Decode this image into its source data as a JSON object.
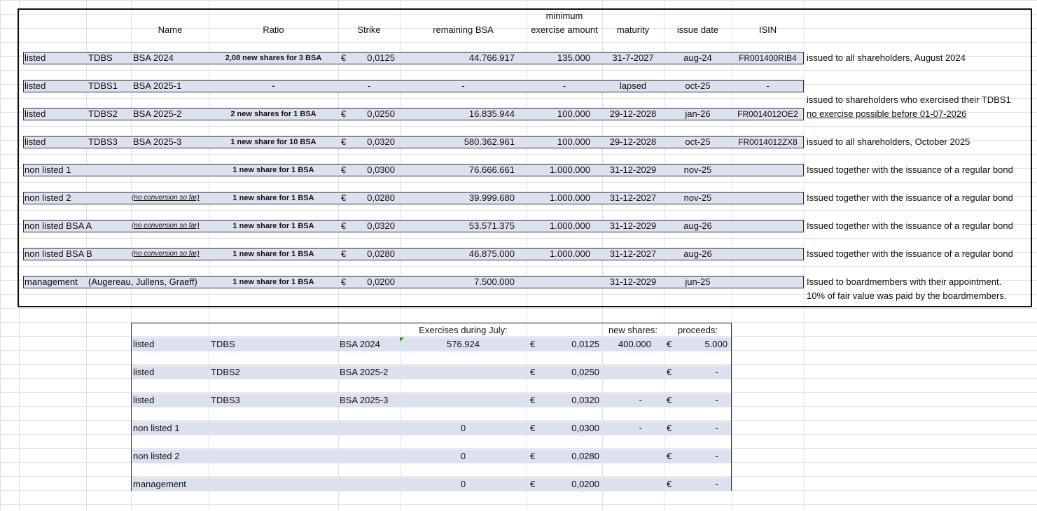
{
  "headers": {
    "name": "Name",
    "ratio": "Ratio",
    "strike": "Strike",
    "remaining": "remaining BSA",
    "min_line1": "minimum",
    "min_line2": "exercise amount",
    "maturity": "maturity",
    "issue_date": "issue date",
    "isin": "ISIN"
  },
  "rows": [
    {
      "status": "listed",
      "code": "TDBS",
      "name": "BSA 2024",
      "ratio": "2,08 new shares for 3 BSA",
      "cur": "€",
      "strike": "0,0125",
      "remaining": "44.766.917",
      "min": "135.000",
      "maturity": "31-7-2027",
      "issue": "aug-24",
      "isin": "FR001400RIB4",
      "note": "issued to all shareholders, August 2024"
    },
    {
      "status": "listed",
      "code": "TDBS1",
      "name": "BSA 2025-1",
      "ratio": "-",
      "cur": "",
      "strike": "-",
      "remaining": "-",
      "min": "-",
      "maturity": "lapsed",
      "issue": "oct-25",
      "isin": "-",
      "note": ""
    },
    {
      "status": "listed",
      "code": "TDBS2",
      "name": "BSA 2025-2",
      "ratio": "2 new shares for 1 BSA",
      "cur": "€",
      "strike": "0,0250",
      "remaining": "16.835.944",
      "min": "100.000",
      "maturity": "29-12-2028",
      "issue": "jan-26",
      "isin": "FR0014012OE2",
      "note_above": "issued to shareholders who exercised their TDBS1",
      "note": "no exercise possible before 01-07-2026"
    },
    {
      "status": "listed",
      "code": "TDBS3",
      "name": "BSA 2025-3",
      "ratio": "1 new share for 10 BSA",
      "cur": "€",
      "strike": "0,0320",
      "remaining": "580.362.961",
      "min": "100.000",
      "maturity": "29-12-2028",
      "issue": "oct-25",
      "isin": "FR0014012ZX8",
      "note": "issued to all shareholders, October 2025"
    },
    {
      "status": "non listed 1",
      "code": "",
      "name": "",
      "ratio": "1 new share for 1 BSA",
      "cur": "€",
      "strike": "0,0300",
      "remaining": "76.666.661",
      "min": "1.000.000",
      "maturity": "31-12-2029",
      "issue": "nov-25",
      "isin": "",
      "note": "Issued together with the issuance of a regular bond"
    },
    {
      "status": "non listed 2",
      "code": "",
      "name": "(no conversion so far)",
      "ratio": "1 new share for 1 BSA",
      "cur": "€",
      "strike": "0,0280",
      "remaining": "39.999.680",
      "min": "1.000.000",
      "maturity": "31-12-2027",
      "issue": "nov-25",
      "isin": "",
      "note": "Issued together with the issuance of a regular bond"
    },
    {
      "status": "non listed BSA A",
      "code": "",
      "name": "(no conversion so far)",
      "ratio": "1 new share for 1 BSA",
      "cur": "€",
      "strike": "0,0320",
      "remaining": "53.571.375",
      "min": "1.000.000",
      "maturity": "31-12-2029",
      "issue": "aug-26",
      "isin": "",
      "note": "Issued together with the issuance of a regular bond"
    },
    {
      "status": "non listed BSA B",
      "code": "",
      "name": "(no conversion so far)",
      "ratio": "1 new share for 1 BSA",
      "cur": "€",
      "strike": "0,0280",
      "remaining": "46.875.000",
      "min": "1.000.000",
      "maturity": "31-12-2027",
      "issue": "aug-26",
      "isin": "",
      "note": "Issued together with the issuance of a regular bond"
    },
    {
      "status": "management",
      "code": "(Augereau, Jullens, Graeff)",
      "name": "",
      "ratio": "1 new share for 1 BSA",
      "cur": "€",
      "strike": "0,0200",
      "remaining": "7.500.000",
      "min": "",
      "maturity": "31-12-2029",
      "issue": "jun-25",
      "isin": "",
      "note": "Issued to boardmembers with their appointment.",
      "note_below": "10% of fair value was paid by the boardmembers."
    }
  ],
  "exercises": {
    "header_exercises": "Exercises during July:",
    "header_new_shares": "new shares:",
    "header_proceeds": "proceeds:",
    "rows": [
      {
        "status": "listed",
        "code": "TDBS",
        "name": "BSA 2024",
        "count": "576.924",
        "cur": "€",
        "strike": "0,0125",
        "new_shares": "400.000",
        "cur2": "€",
        "proceeds": "5.000"
      },
      {
        "status": "listed",
        "code": "TDBS2",
        "name": "BSA 2025-2",
        "count": "",
        "cur": "€",
        "strike": "0,0250",
        "new_shares": "",
        "cur2": "€",
        "proceeds": "-"
      },
      {
        "status": "listed",
        "code": "TDBS3",
        "name": "BSA 2025-3",
        "count": "",
        "cur": "€",
        "strike": "0,0320",
        "new_shares": "-",
        "cur2": "€",
        "proceeds": "-"
      },
      {
        "status": "non listed 1",
        "code": "",
        "name": "",
        "count": "0",
        "cur": "€",
        "strike": "0,0300",
        "new_shares": "-",
        "cur2": "€",
        "proceeds": "-"
      },
      {
        "status": "non listed 2",
        "code": "",
        "name": "",
        "count": "0",
        "cur": "€",
        "strike": "0,0280",
        "new_shares": "",
        "cur2": "€",
        "proceeds": "-"
      },
      {
        "status": "management",
        "code": "",
        "name": "",
        "count": "0",
        "cur": "€",
        "strike": "0,0200",
        "new_shares": "",
        "cur2": "€",
        "proceeds": "-"
      }
    ]
  }
}
